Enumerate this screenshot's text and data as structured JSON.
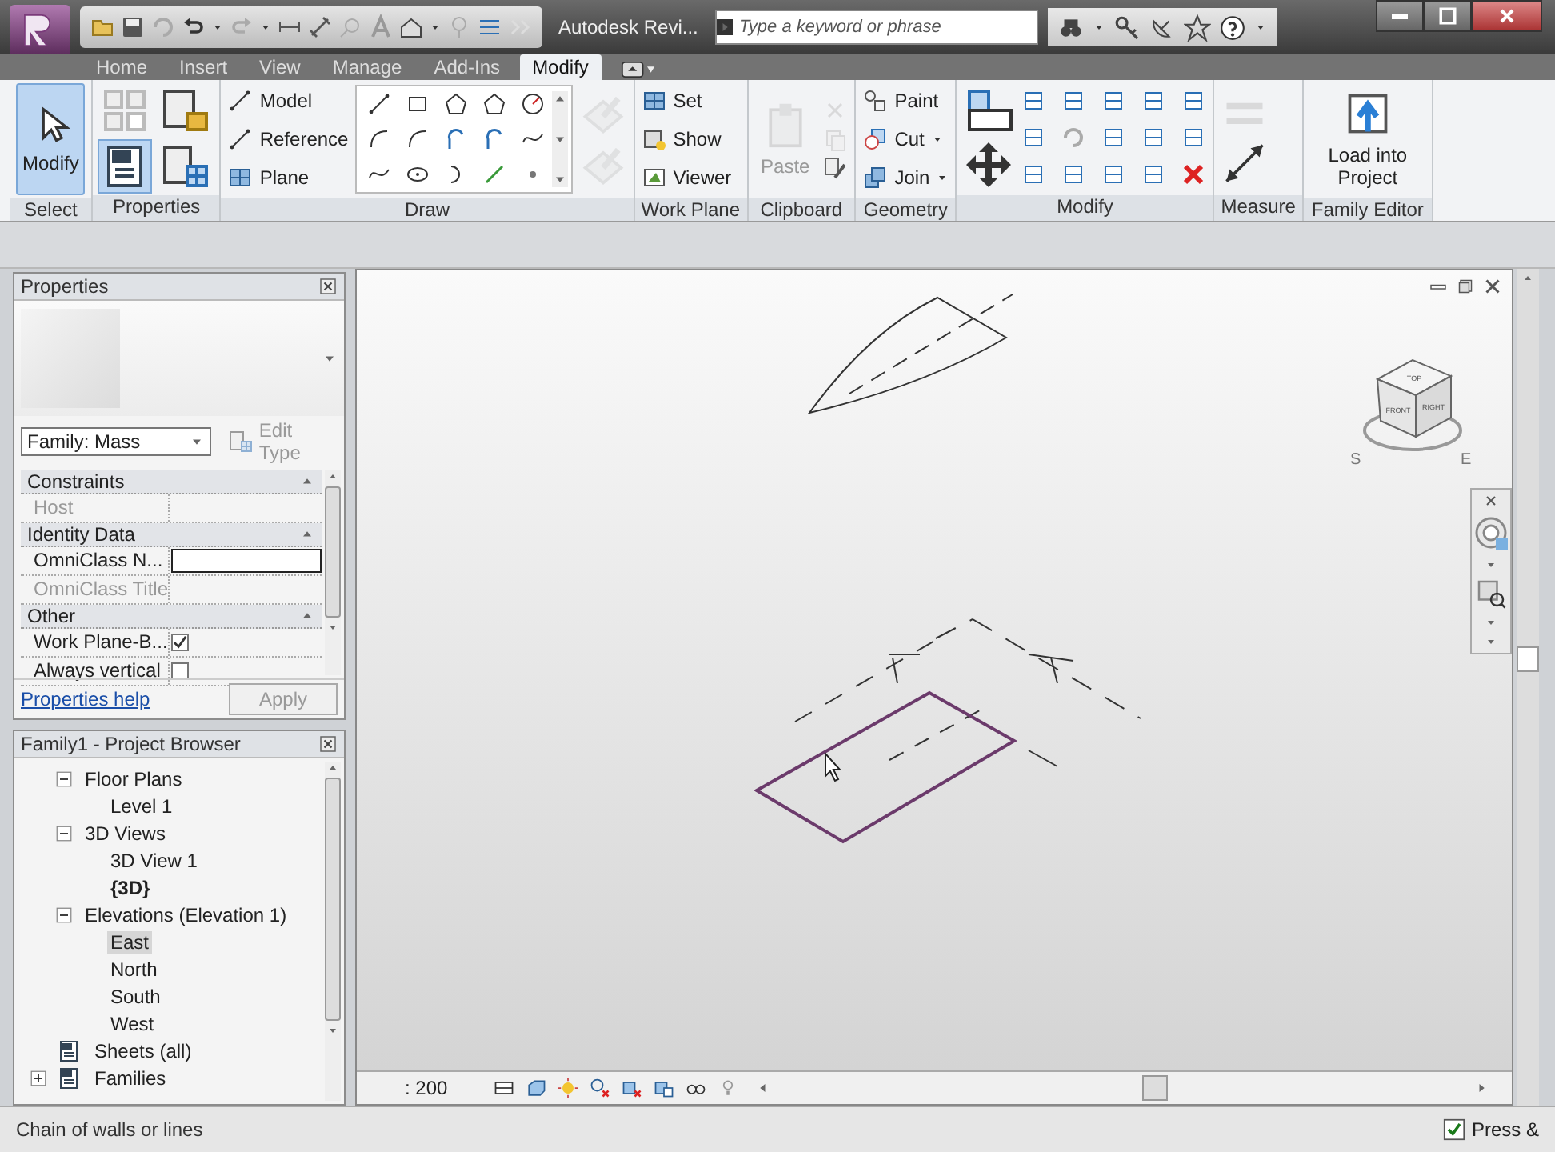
{
  "window": {
    "title": "Autodesk Revi..."
  },
  "search": {
    "placeholder": "Type a keyword or phrase"
  },
  "tabs": [
    {
      "label": "Home",
      "selected": false
    },
    {
      "label": "Insert",
      "selected": false
    },
    {
      "label": "View",
      "selected": false
    },
    {
      "label": "Manage",
      "selected": false
    },
    {
      "label": "Add-Ins",
      "selected": false
    },
    {
      "label": "Modify",
      "selected": true
    }
  ],
  "ribbon": [
    {
      "title": "Select",
      "kind": "select",
      "tools": [
        {
          "label": "Modify",
          "selected": true,
          "disabled": false
        }
      ]
    },
    {
      "title": "Properties",
      "kind": "properties"
    },
    {
      "title": "Draw",
      "kind": "draw",
      "tools": [
        {
          "label": "Model",
          "disabled": false
        },
        {
          "label": "Reference",
          "disabled": false
        },
        {
          "label": "Plane",
          "disabled": false
        }
      ]
    },
    {
      "title": "Work Plane",
      "kind": "workplane",
      "tools": [
        {
          "label": "Set",
          "disabled": false
        },
        {
          "label": "Show",
          "disabled": false
        },
        {
          "label": "Viewer",
          "disabled": false
        }
      ]
    },
    {
      "title": "Clipboard",
      "kind": "clipboard",
      "tools": [
        {
          "label": "Paste",
          "disabled": true
        }
      ]
    },
    {
      "title": "Geometry",
      "kind": "geometry",
      "tools": [
        {
          "label": "Paint",
          "disabled": false
        },
        {
          "label": "Cut",
          "disabled": false
        },
        {
          "label": "Join",
          "disabled": false
        }
      ]
    },
    {
      "title": "Modify",
      "kind": "modify"
    },
    {
      "title": "Measure",
      "kind": "measure"
    },
    {
      "title": "Family Editor",
      "kind": "family",
      "tools": [
        {
          "label": "Load into Project",
          "disabled": false
        }
      ]
    }
  ],
  "properties": {
    "title": "Properties",
    "type_selector": "Family: Mass",
    "edit_type": {
      "label": "Edit Type",
      "disabled": true
    },
    "groups": [
      {
        "title": "Constraints",
        "expanded": true,
        "rows": [
          {
            "name": "Host",
            "kind": "text",
            "disabled": true
          }
        ]
      },
      {
        "title": "Identity Data",
        "expanded": true,
        "rows": [
          {
            "name": "OmniClass N...",
            "kind": "field",
            "disabled": false
          },
          {
            "name": "OmniClass Title",
            "kind": "text",
            "disabled": true
          }
        ]
      },
      {
        "title": "Other",
        "expanded": true,
        "rows": [
          {
            "name": "Work Plane-B...",
            "kind": "checkbox",
            "checked": true,
            "disabled": false
          },
          {
            "name": "Always vertical",
            "kind": "checkbox",
            "checked": false,
            "disabled": false
          }
        ]
      }
    ],
    "help_link": "Properties help",
    "apply": {
      "label": "Apply",
      "disabled": true
    }
  },
  "project_browser": {
    "title": "Family1 - Project Browser",
    "tree": [
      {
        "label": "Floor Plans",
        "kind": "group",
        "expanded": true,
        "selected": false,
        "children": [
          {
            "label": "Level 1",
            "selected": false,
            "current": false
          }
        ]
      },
      {
        "label": "3D Views",
        "kind": "group",
        "expanded": true,
        "selected": false,
        "children": [
          {
            "label": "3D View 1",
            "selected": false,
            "current": false
          },
          {
            "label": "{3D}",
            "selected": false,
            "current": true
          }
        ]
      },
      {
        "label": "Elevations (Elevation 1)",
        "kind": "group",
        "expanded": true,
        "selected": false,
        "children": [
          {
            "label": "East",
            "selected": true,
            "current": false
          },
          {
            "label": "North",
            "selected": false,
            "current": false
          },
          {
            "label": "South",
            "selected": false,
            "current": false
          },
          {
            "label": "West",
            "selected": false,
            "current": false
          }
        ]
      },
      {
        "label": "Sheets (all)",
        "kind": "root",
        "selected": false
      },
      {
        "label": "Families",
        "kind": "root",
        "expanded": false,
        "selected": false
      }
    ]
  },
  "viewcube": {
    "faces": [
      "TOP",
      "FRONT",
      "RIGHT"
    ],
    "compass": [
      "S",
      "E"
    ]
  },
  "view_bar": {
    "scale": ": 200"
  },
  "status_bar": {
    "prompt": "Chain of walls or lines",
    "press_drag": {
      "label": "Press &",
      "checked": true
    }
  }
}
